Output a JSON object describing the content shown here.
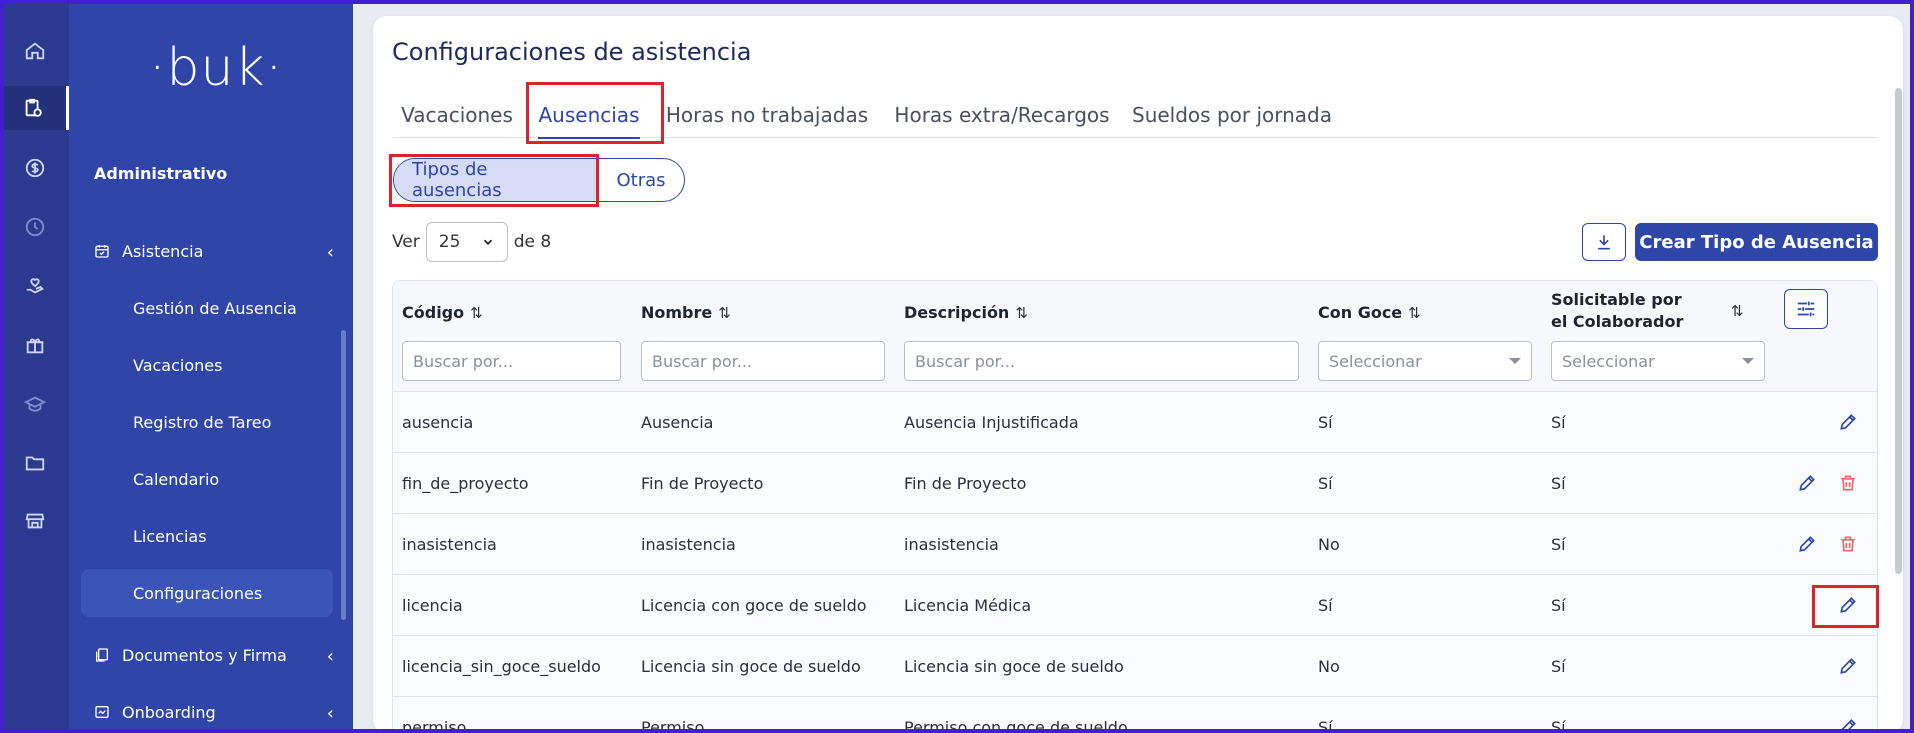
{
  "colors": {
    "rail": "#2b3a8f",
    "sidebar": "#2f45a8",
    "accent": "#2e46a8",
    "danger": "#e0202a",
    "highlight_box": "#e0202a"
  },
  "rail": {
    "icons": [
      "home-icon",
      "clipboard-clock-icon",
      "dollar-icon",
      "clock-icon",
      "hand-heart-icon",
      "gift-icon",
      "graduation-cap-icon",
      "folder-icon",
      "store-icon"
    ]
  },
  "sidebar": {
    "logo": "·buk·",
    "section_title": "Administrativo",
    "groups": [
      {
        "label": "Asistencia",
        "icon": "calendar-check-icon",
        "expanded": true
      },
      {
        "label": "Documentos y Firma",
        "icon": "documents-icon",
        "expanded": false
      },
      {
        "label": "Onboarding",
        "icon": "onboarding-icon",
        "expanded": false
      }
    ],
    "sub_items": [
      {
        "label": "Gestión de Ausencia"
      },
      {
        "label": "Vacaciones"
      },
      {
        "label": "Registro de Tareo"
      },
      {
        "label": "Calendario"
      },
      {
        "label": "Licencias"
      },
      {
        "label": "Configuraciones",
        "active": true
      }
    ]
  },
  "page": {
    "title": "Configuraciones de asistencia",
    "tabs": [
      "Vacaciones",
      "Ausencias",
      "Horas no trabajadas",
      "Horas extra/Recargos",
      "Sueldos por jornada"
    ],
    "active_tab": "Ausencias",
    "subtabs": [
      "Tipos de ausencias",
      "Otras"
    ],
    "active_subtab": "Tipos de ausencias",
    "ver_label": "Ver",
    "page_size": "25",
    "of_label": "de 8",
    "create_button": "Crear Tipo de Ausencia",
    "download_icon": "download-icon"
  },
  "table": {
    "columns": [
      "Código",
      "Nombre",
      "Descripción",
      "Con Goce",
      "Solicitable por el Colaborador"
    ],
    "filters": [
      "Buscar por...",
      "Buscar por...",
      "Buscar por...",
      "Seleccionar",
      "Seleccionar"
    ],
    "rows": [
      {
        "codigo": "ausencia",
        "nombre": "Ausencia",
        "descripcion": "Ausencia Injustificada",
        "con_goce": "Sí",
        "solicitable": "Sí",
        "deletable": false
      },
      {
        "codigo": "fin_de_proyecto",
        "nombre": "Fin de Proyecto",
        "descripcion": "Fin de Proyecto",
        "con_goce": "Sí",
        "solicitable": "Sí",
        "deletable": true
      },
      {
        "codigo": "inasistencia",
        "nombre": "inasistencia",
        "descripcion": "inasistencia",
        "con_goce": "No",
        "solicitable": "Sí",
        "deletable": true
      },
      {
        "codigo": "licencia",
        "nombre": "Licencia con goce de sueldo",
        "descripcion": "Licencia Médica",
        "con_goce": "Sí",
        "solicitable": "Sí",
        "deletable": false
      },
      {
        "codigo": "licencia_sin_goce_sueldo",
        "nombre": "Licencia sin goce de sueldo",
        "descripcion": "Licencia sin goce de sueldo",
        "con_goce": "No",
        "solicitable": "Sí",
        "deletable": false
      },
      {
        "codigo": "permiso",
        "nombre": "Permiso",
        "descripcion": "Permiso con goce de sueldo",
        "con_goce": "Sí",
        "solicitable": "Sí",
        "deletable": false
      }
    ]
  }
}
